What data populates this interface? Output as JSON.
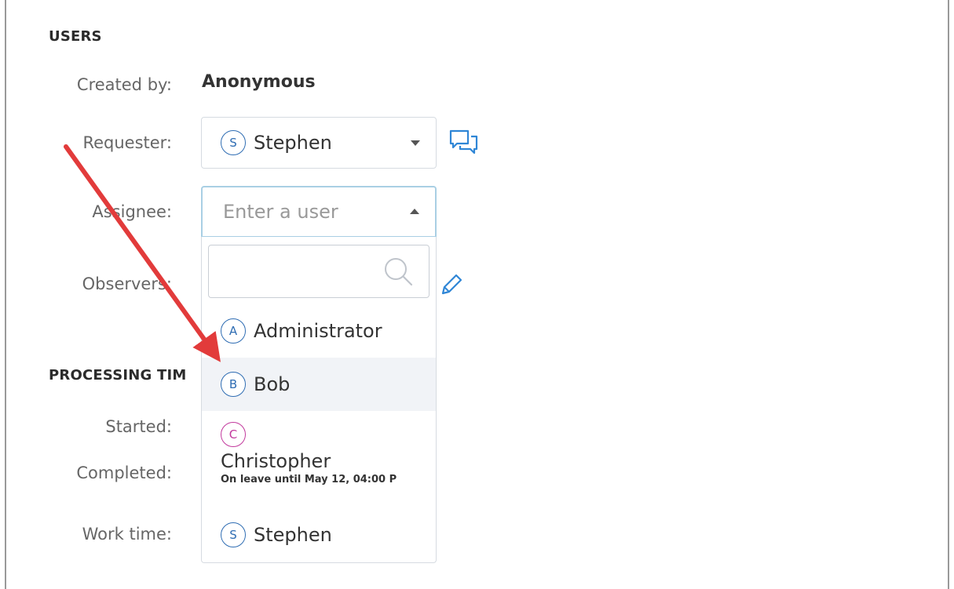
{
  "users_section": {
    "title": "USERS",
    "created_by_label": "Created by:",
    "created_by_value": "Anonymous",
    "requester_label": "Requester:",
    "requester": {
      "initial": "S",
      "name": "Stephen"
    },
    "assignee_label": "Assignee:",
    "assignee_placeholder": "Enter a user",
    "observers_label": "Observers:"
  },
  "assignee_dropdown": {
    "search_value": "",
    "options": [
      {
        "initial": "A",
        "name": "Administrator",
        "note": ""
      },
      {
        "initial": "B",
        "name": "Bob",
        "note": ""
      },
      {
        "initial": "C",
        "name": "Christopher",
        "note": "On leave until May 12, 04:00 P"
      },
      {
        "initial": "S",
        "name": "Stephen",
        "note": ""
      }
    ]
  },
  "processing_section": {
    "title": "PROCESSING TIM",
    "started_label": "Started:",
    "completed_label": "Completed:",
    "work_time_label": "Work time:"
  },
  "colors": {
    "avatar_blue": "#2f6db3",
    "avatar_pink": "#c2399d",
    "annotation_arrow": "#e23b3b",
    "icon_blue": "#2f86d6"
  }
}
